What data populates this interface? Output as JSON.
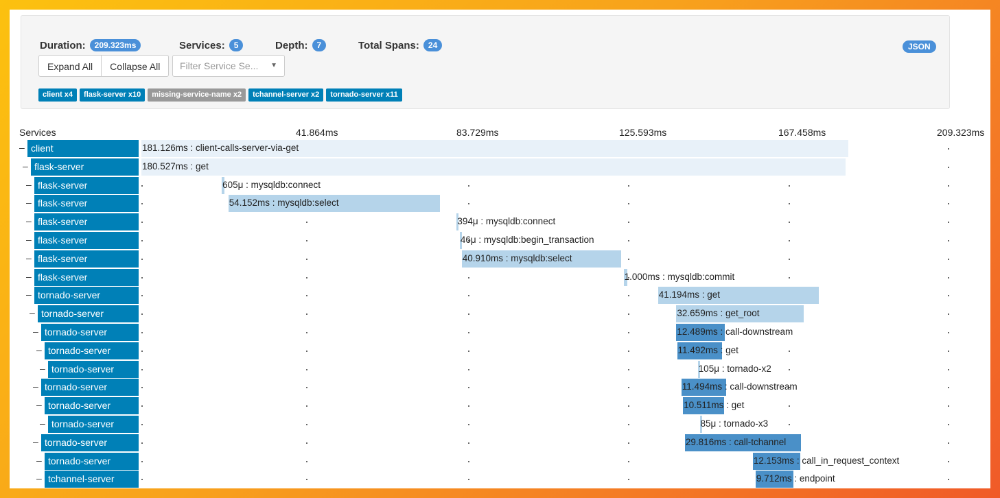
{
  "summary": {
    "duration_label": "Duration:",
    "duration_value": "209.323ms",
    "services_label": "Services:",
    "services_value": "5",
    "depth_label": "Depth:",
    "depth_value": "7",
    "spans_label": "Total Spans:",
    "spans_value": "24",
    "json_label": "JSON",
    "expand_all": "Expand All",
    "collapse_all": "Collapse All",
    "filter_placeholder": "Filter Service Se...",
    "chips": [
      {
        "label": "client x4",
        "color": "#0080b7"
      },
      {
        "label": "flask-server x10",
        "color": "#0080b7"
      },
      {
        "label": "missing-service-name x2",
        "color": "#999999"
      },
      {
        "label": "tchannel-server x2",
        "color": "#0080b7"
      },
      {
        "label": "tornado-server x11",
        "color": "#0080b7"
      }
    ]
  },
  "timeline": {
    "services_header": "Services",
    "ticks": [
      "41.864ms",
      "83.729ms",
      "125.593ms",
      "167.458ms",
      "209.323ms"
    ],
    "total_ms": 209.323,
    "spans": [
      {
        "service": "client",
        "depth": 0,
        "label": "181.126ms : client-calls-server-via-get",
        "start_ms": 0,
        "duration_ms": 181.126
      },
      {
        "service": "flask-server",
        "depth": 1,
        "label": "180.527ms : get",
        "start_ms": 0,
        "duration_ms": 180.527
      },
      {
        "service": "flask-server",
        "depth": 2,
        "label": "605μ : mysqldb:connect",
        "start_ms": 20.6,
        "duration_ms": 0.605
      },
      {
        "service": "flask-server",
        "depth": 2,
        "label": "54.152ms : mysqldb:select",
        "start_ms": 22.3,
        "duration_ms": 54.152
      },
      {
        "service": "flask-server",
        "depth": 2,
        "label": "394μ : mysqldb:connect",
        "start_ms": 80.8,
        "duration_ms": 0.394
      },
      {
        "service": "flask-server",
        "depth": 2,
        "label": "46μ : mysqldb:begin_transaction",
        "start_ms": 81.6,
        "duration_ms": 0.046
      },
      {
        "service": "flask-server",
        "depth": 2,
        "label": "40.910ms : mysqldb:select",
        "start_ms": 82.1,
        "duration_ms": 40.91
      },
      {
        "service": "flask-server",
        "depth": 2,
        "label": "1.000ms : mysqldb:commit",
        "start_ms": 123.6,
        "duration_ms": 1.0
      },
      {
        "service": "tornado-server",
        "depth": 2,
        "label": "41.194ms : get",
        "start_ms": 132.4,
        "duration_ms": 41.194
      },
      {
        "service": "tornado-server",
        "depth": 3,
        "label": "32.659ms : get_root",
        "start_ms": 137.1,
        "duration_ms": 32.659
      },
      {
        "service": "tornado-server",
        "depth": 4,
        "label": "12.489ms : call-downstream",
        "start_ms": 137.1,
        "duration_ms": 12.489
      },
      {
        "service": "tornado-server",
        "depth": 5,
        "label": "11.492ms : get",
        "start_ms": 137.3,
        "duration_ms": 11.492
      },
      {
        "service": "tornado-server",
        "depth": 6,
        "label": "105μ : tornado-x2",
        "start_ms": 142.6,
        "duration_ms": 0.105
      },
      {
        "service": "tornado-server",
        "depth": 4,
        "label": "11.494ms : call-downstream",
        "start_ms": 138.4,
        "duration_ms": 11.494
      },
      {
        "service": "tornado-server",
        "depth": 5,
        "label": "10.511ms : get",
        "start_ms": 138.8,
        "duration_ms": 10.511
      },
      {
        "service": "tornado-server",
        "depth": 6,
        "label": "85μ : tornado-x3",
        "start_ms": 143.1,
        "duration_ms": 0.085
      },
      {
        "service": "tornado-server",
        "depth": 4,
        "label": "29.816ms : call-tchannel",
        "start_ms": 139.3,
        "duration_ms": 29.816
      },
      {
        "service": "tornado-server",
        "depth": 5,
        "label": "12.153ms : call_in_request_context",
        "start_ms": 156.7,
        "duration_ms": 12.153
      },
      {
        "service": "tchannel-server",
        "depth": 5,
        "label": "9.712ms : endpoint",
        "start_ms": 157.4,
        "duration_ms": 9.712
      }
    ]
  }
}
